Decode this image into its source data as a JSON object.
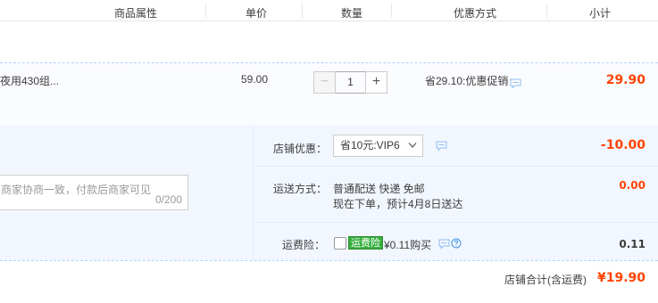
{
  "columns": {
    "attr": "商品属性",
    "price": "单价",
    "qty": "数量",
    "promo": "优惠方式",
    "subtotal": "小计"
  },
  "item": {
    "title": "夜用430组...",
    "price": "59.00",
    "quantity": "1",
    "minus": "−",
    "plus": "+",
    "promo": "省29.10:优惠促销",
    "subtotal": "29.90"
  },
  "shop": {
    "discount_label": "店铺优惠：",
    "discount_option": "省10元:VIP6",
    "discount_value": "-10.00",
    "shipping_label": "运送方式：",
    "shipping_method": "普通配送 快递 免邮",
    "shipping_eta": "现在下单，预计4月8日送达",
    "shipping_value": "0.00",
    "insurance_label": "运费险：",
    "insurance_badge": "运费险",
    "insurance_text": "¥0.11购买",
    "insurance_value": "0.11",
    "message_placeholder": "商家协商一致，付款后商家可见",
    "message_count": "0/200",
    "total_label": "店铺合计(含运费)",
    "total_value": "¥19.90"
  },
  "colors": {
    "accent": "#ff4400",
    "link_blue": "#3d8fe0",
    "insurance_green": "#38b03f",
    "panel_bg": "#f2f7ff"
  },
  "icons": [
    "chat-bubble-icon",
    "chevron-down-icon",
    "help-circle-icon",
    "checkbox-icon"
  ]
}
